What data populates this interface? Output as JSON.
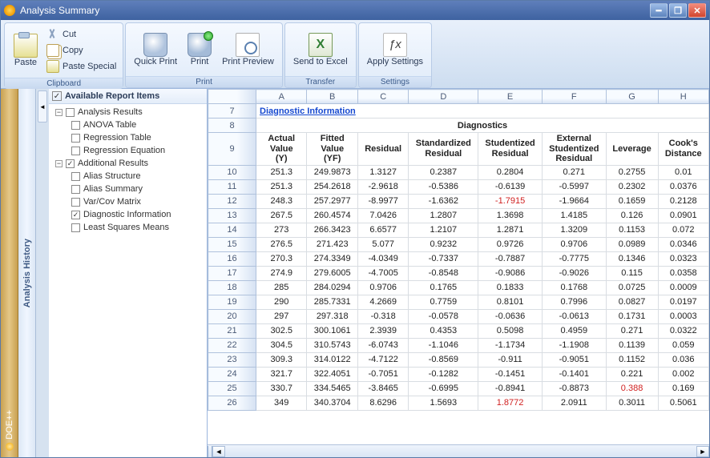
{
  "window": {
    "title": "Analysis Summary"
  },
  "ribbon": {
    "groups": {
      "clipboard": {
        "label": "Clipboard",
        "paste": "Paste",
        "cut": "Cut",
        "copy": "Copy",
        "paste_special": "Paste Special"
      },
      "print": {
        "label": "Print",
        "quick_print": "Quick Print",
        "print": "Print",
        "preview": "Print Preview"
      },
      "transfer": {
        "label": "Transfer",
        "send_excel": "Send to Excel"
      },
      "settings": {
        "label": "Settings",
        "apply": "Apply Settings"
      }
    }
  },
  "side": {
    "brand": "DOE++",
    "history": "Analysis History"
  },
  "tree": {
    "header": "Available Report Items",
    "groups": [
      {
        "label": "Analysis Results",
        "checked": false,
        "items": [
          {
            "label": "ANOVA Table",
            "checked": false
          },
          {
            "label": "Regression Table",
            "checked": false
          },
          {
            "label": "Regression Equation",
            "checked": false
          }
        ]
      },
      {
        "label": "Additional Results",
        "checked": true,
        "items": [
          {
            "label": "Alias Structure",
            "checked": false
          },
          {
            "label": "Alias Summary",
            "checked": false
          },
          {
            "label": "Var/Cov Matrix",
            "checked": false
          },
          {
            "label": "Diagnostic Information",
            "checked": true
          },
          {
            "label": "Least Squares Means",
            "checked": false
          }
        ]
      }
    ]
  },
  "sheet": {
    "section_title": "Diagnostic Information",
    "diag_header": "Diagnostics",
    "columns_letters": [
      "A",
      "B",
      "C",
      "D",
      "E",
      "F",
      "G",
      "H"
    ],
    "first_rownum": 7,
    "col_headers": [
      "Actual Value (Y)",
      "Fitted Value (YF)",
      "Residual",
      "Standardized Residual",
      "Studentized Residual",
      "External Studentized Residual",
      "Leverage",
      "Cook's Distance"
    ],
    "highlight": {
      "row": 25,
      "col": 6
    }
  },
  "chart_data": {
    "type": "table",
    "title": "Diagnostics",
    "columns": [
      "Actual Value (Y)",
      "Fitted Value (YF)",
      "Residual",
      "Standardized Residual",
      "Studentized Residual",
      "External Studentized Residual",
      "Leverage",
      "Cook's Distance"
    ],
    "row_numbers": [
      10,
      11,
      12,
      13,
      14,
      15,
      16,
      17,
      18,
      19,
      20,
      21,
      22,
      23,
      24,
      25,
      26
    ],
    "rows": [
      [
        251.3,
        249.9873,
        1.3127,
        0.2387,
        0.2804,
        0.271,
        0.2755,
        0.01
      ],
      [
        251.3,
        254.2618,
        -2.9618,
        -0.5386,
        -0.6139,
        -0.5997,
        0.2302,
        0.0376
      ],
      [
        248.3,
        257.2977,
        -8.9977,
        -1.6362,
        -1.7915,
        -1.9664,
        0.1659,
        0.2128
      ],
      [
        267.5,
        260.4574,
        7.0426,
        1.2807,
        1.3698,
        1.4185,
        0.126,
        0.0901
      ],
      [
        273,
        266.3423,
        6.6577,
        1.2107,
        1.2871,
        1.3209,
        0.1153,
        0.072
      ],
      [
        276.5,
        271.423,
        5.077,
        0.9232,
        0.9726,
        0.9706,
        0.0989,
        0.0346
      ],
      [
        270.3,
        274.3349,
        -4.0349,
        -0.7337,
        -0.7887,
        -0.7775,
        0.1346,
        0.0323
      ],
      [
        274.9,
        279.6005,
        -4.7005,
        -0.8548,
        -0.9086,
        -0.9026,
        0.115,
        0.0358
      ],
      [
        285,
        284.0294,
        0.9706,
        0.1765,
        0.1833,
        0.1768,
        0.0725,
        0.0009
      ],
      [
        290,
        285.7331,
        4.2669,
        0.7759,
        0.8101,
        0.7996,
        0.0827,
        0.0197
      ],
      [
        297,
        297.318,
        -0.318,
        -0.0578,
        -0.0636,
        -0.0613,
        0.1731,
        0.0003
      ],
      [
        302.5,
        300.1061,
        2.3939,
        0.4353,
        0.5098,
        0.4959,
        0.271,
        0.0322
      ],
      [
        304.5,
        310.5743,
        -6.0743,
        -1.1046,
        -1.1734,
        -1.1908,
        0.1139,
        0.059
      ],
      [
        309.3,
        314.0122,
        -4.7122,
        -0.8569,
        -0.911,
        -0.9051,
        0.1152,
        0.036
      ],
      [
        321.7,
        322.4051,
        -0.7051,
        -0.1282,
        -0.1451,
        -0.1401,
        0.221,
        0.002
      ],
      [
        330.7,
        334.5465,
        -3.8465,
        -0.6995,
        -0.8941,
        -0.8873,
        0.388,
        0.169
      ],
      [
        349,
        340.3704,
        8.6296,
        1.5693,
        1.8772,
        2.0911,
        0.3011,
        0.5061
      ]
    ],
    "flagged_cells": [
      {
        "row_number": 12,
        "column": "Studentized Residual",
        "value": -1.7915
      },
      {
        "row_number": 25,
        "column": "Leverage",
        "value": 0.388
      },
      {
        "row_number": 26,
        "column": "Studentized Residual",
        "value": 1.8772
      }
    ]
  }
}
